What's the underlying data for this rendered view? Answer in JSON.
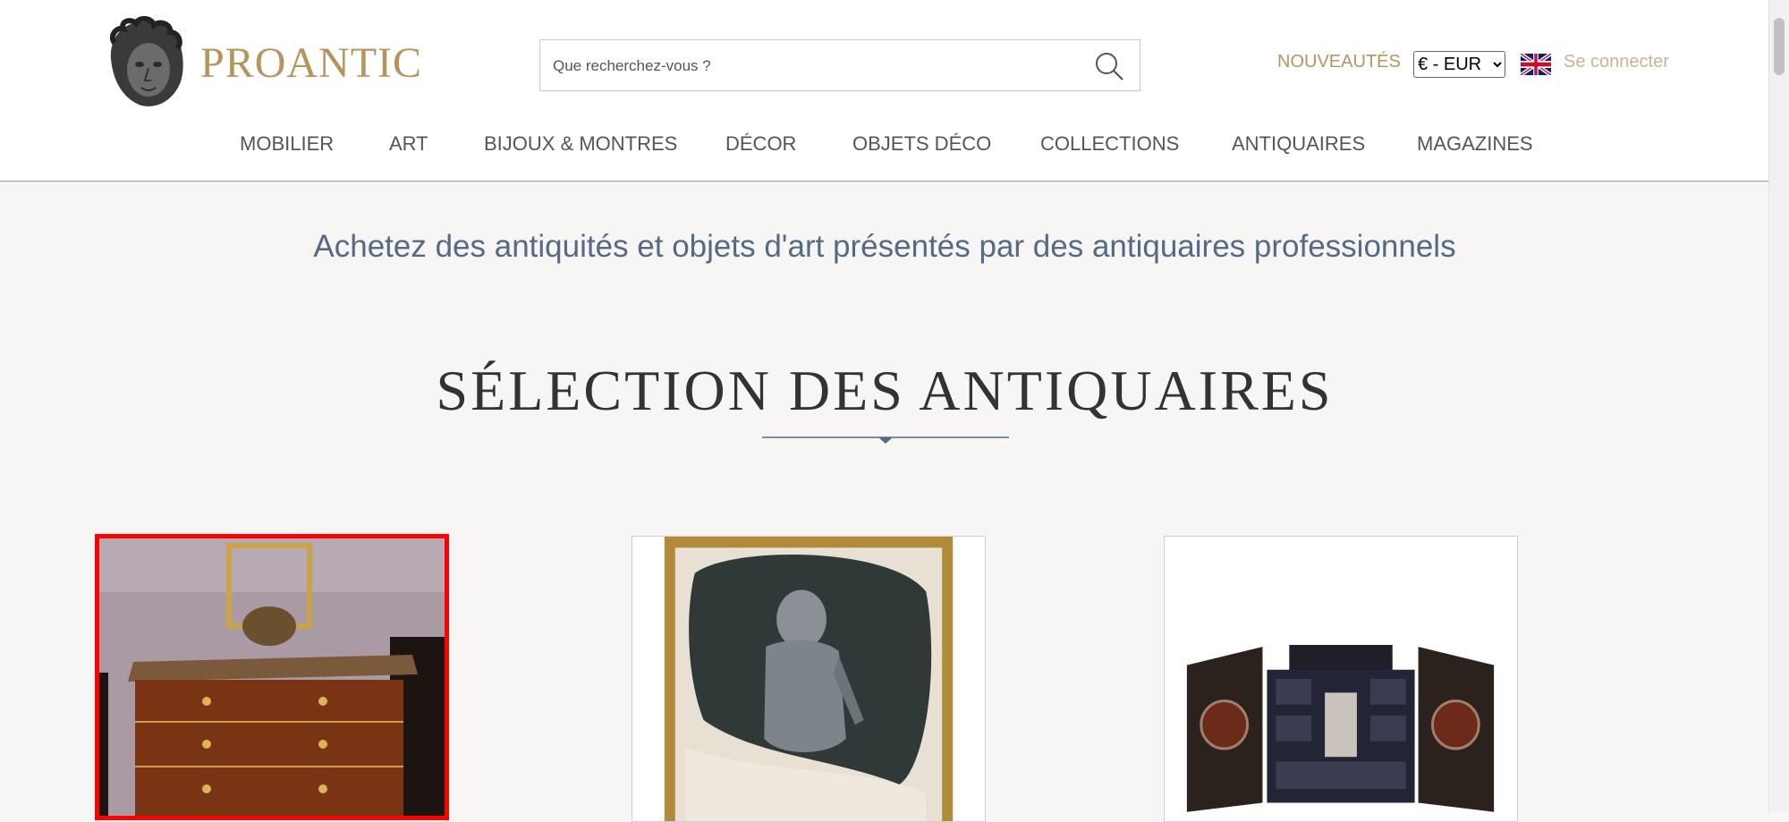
{
  "header": {
    "brand": "PROANTIC",
    "search_placeholder": "Que recherchez-vous ?",
    "new_link": "NOUVEAUTÉS",
    "currency": "€ - EUR",
    "login": "Se connecter",
    "colors": {
      "gold": "#b8945c",
      "muted_gold": "#c9b58e",
      "blue_grey": "#546a85"
    }
  },
  "nav": [
    "MOBILIER",
    "ART",
    "BIJOUX & MONTRES",
    "DÉCOR",
    "OBJETS DÉCO",
    "COLLECTIONS",
    "ANTIQUAIRES",
    "MAGAZINES"
  ],
  "main": {
    "tagline": "Achetez des antiquités et objets d'art présentés par des antiquaires professionnels",
    "section_title": "SÉLECTION DES ANTIQUAIRES"
  },
  "products": [
    {
      "image": "commode-louis-xv-image",
      "selected": true
    },
    {
      "image": "knight-armor-painting-image",
      "selected": false
    },
    {
      "image": "cabinet-ebony-image",
      "selected": false
    }
  ]
}
